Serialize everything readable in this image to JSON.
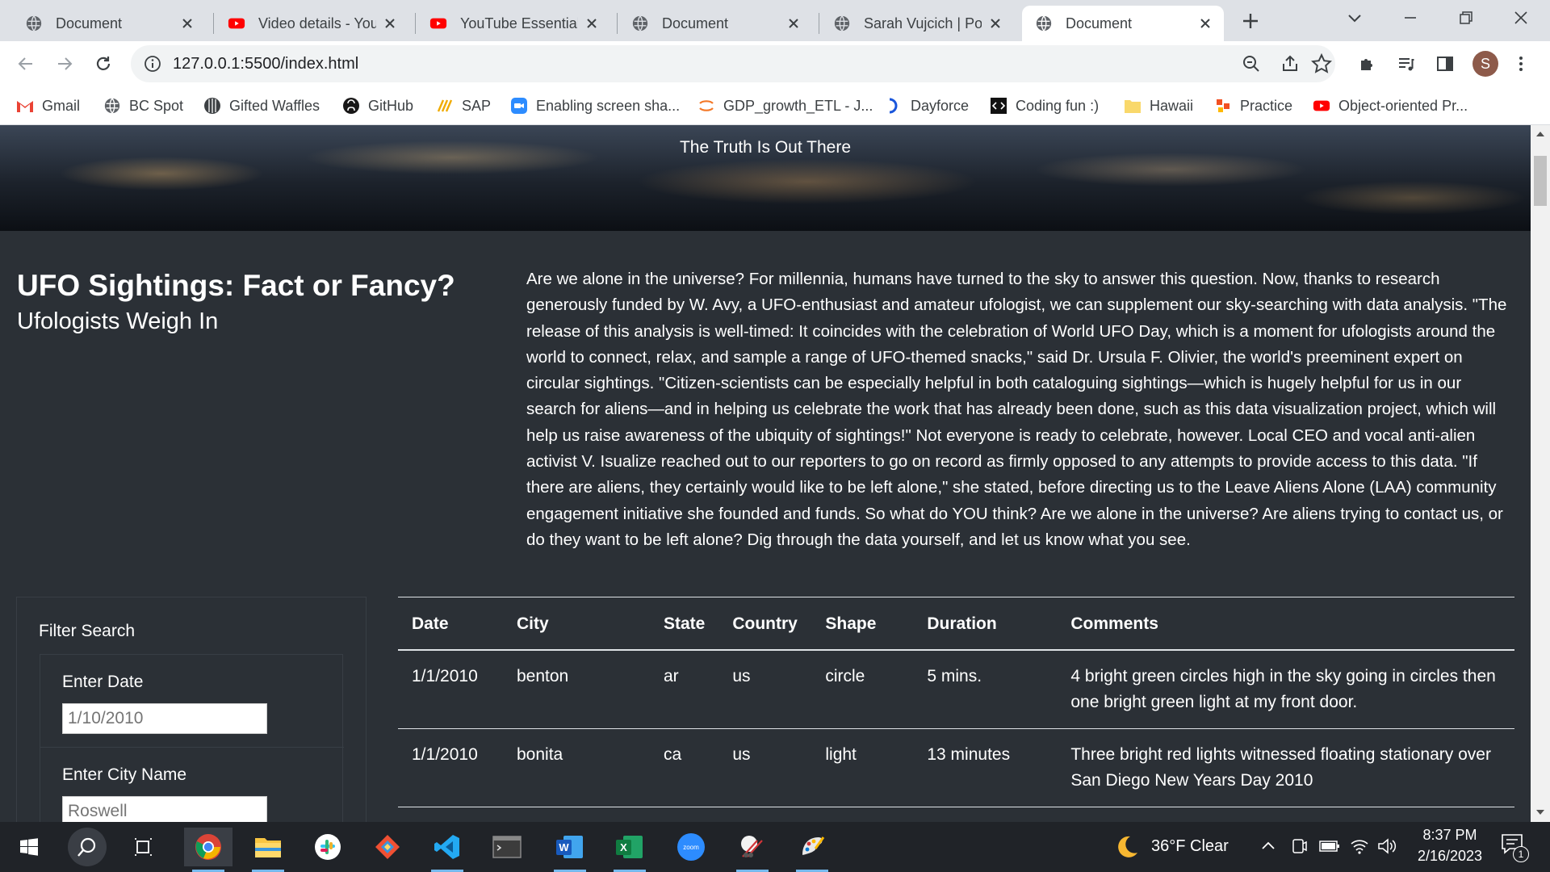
{
  "browser": {
    "tabs": [
      {
        "title": "Document",
        "icon": "globe-icon"
      },
      {
        "title": "Video details - YouTube Studio",
        "icon": "youtube-icon"
      },
      {
        "title": "YouTube Essentials",
        "icon": "youtube-icon"
      },
      {
        "title": "Document",
        "icon": "globe-icon"
      },
      {
        "title": "Sarah Vujcich | Portfolio",
        "icon": "globe-icon"
      },
      {
        "title": "Document",
        "icon": "globe-icon",
        "active": true
      }
    ],
    "url": "127.0.0.1:5500/index.html",
    "profile_initial": "S",
    "bookmarks": [
      {
        "label": "Gmail",
        "icon": "gmail-icon"
      },
      {
        "label": "BC Spot",
        "icon": "globe-icon"
      },
      {
        "label": "Gifted Waffles",
        "icon": "waffle-icon"
      },
      {
        "label": "GitHub",
        "icon": "github-icon"
      },
      {
        "label": "SAP",
        "icon": "sap-icon"
      },
      {
        "label": "Enabling screen sha...",
        "icon": "zoom-icon"
      },
      {
        "label": "GDP_growth_ETL - J...",
        "icon": "jupyter-icon"
      },
      {
        "label": "Dayforce",
        "icon": "dayforce-icon"
      },
      {
        "label": "Coding fun :)",
        "icon": "code-icon"
      },
      {
        "label": "Hawaii",
        "icon": "folder-icon"
      },
      {
        "label": "Practice",
        "icon": "practice-icon"
      },
      {
        "label": "Object-oriented Pr...",
        "icon": "youtube-icon"
      }
    ]
  },
  "page": {
    "tagline": "The Truth Is Out There",
    "headline": "UFO Sightings: Fact or Fancy?",
    "subhead": "Ufologists Weigh In",
    "article": "Are we alone in the universe? For millennia, humans have turned to the sky to answer this question. Now, thanks to research generously funded by W. Avy, a UFO-enthusiast and amateur ufologist, we can supplement our sky-searching with data analysis. \"The release of this analysis is well-timed: It coincides with the celebration of World UFO Day, which is a moment for ufologists around the world to connect, relax, and sample a range of UFO-themed snacks,\" said Dr. Ursula F. Olivier, the world's preeminent expert on circular sightings. \"Citizen-scientists can be especially helpful in both cataloguing sightings—which is hugely helpful for us in our search for aliens—and in helping us celebrate the work that has already been done, such as this data visualization project, which will help us raise awareness of the ubiquity of sightings!\" Not everyone is ready to celebrate, however. Local CEO and vocal anti-alien activist V. Isualize reached out to our reporters to go on record as firmly opposed to any attempts to provide access to this data. \"If there are aliens, they certainly would like to be left alone,\" she stated, before directing us to the Leave Aliens Alone (LAA) community engagement initiative she founded and funds. So what do YOU think? Are we alone in the universe? Are aliens trying to contact us, or do they want to be left alone? Dig through the data yourself, and let us know what you see.",
    "filter": {
      "title": "Filter Search",
      "date_label": "Enter Date",
      "date_placeholder": "1/10/2010",
      "city_label": "Enter City Name",
      "city_placeholder": "Roswell"
    },
    "table": {
      "headers": [
        "Date",
        "City",
        "State",
        "Country",
        "Shape",
        "Duration",
        "Comments"
      ],
      "rows": [
        [
          "1/1/2010",
          "benton",
          "ar",
          "us",
          "circle",
          "5 mins.",
          "4 bright green circles high in the sky going in circles then one bright green light at my front door."
        ],
        [
          "1/1/2010",
          "bonita",
          "ca",
          "us",
          "light",
          "13 minutes",
          "Three bright red lights witnessed floating stationary over San Diego New Years Day 2010"
        ]
      ]
    }
  },
  "taskbar": {
    "weather": "36°F  Clear",
    "time": "8:37 PM",
    "date": "2/16/2023",
    "notification_count": "1"
  }
}
